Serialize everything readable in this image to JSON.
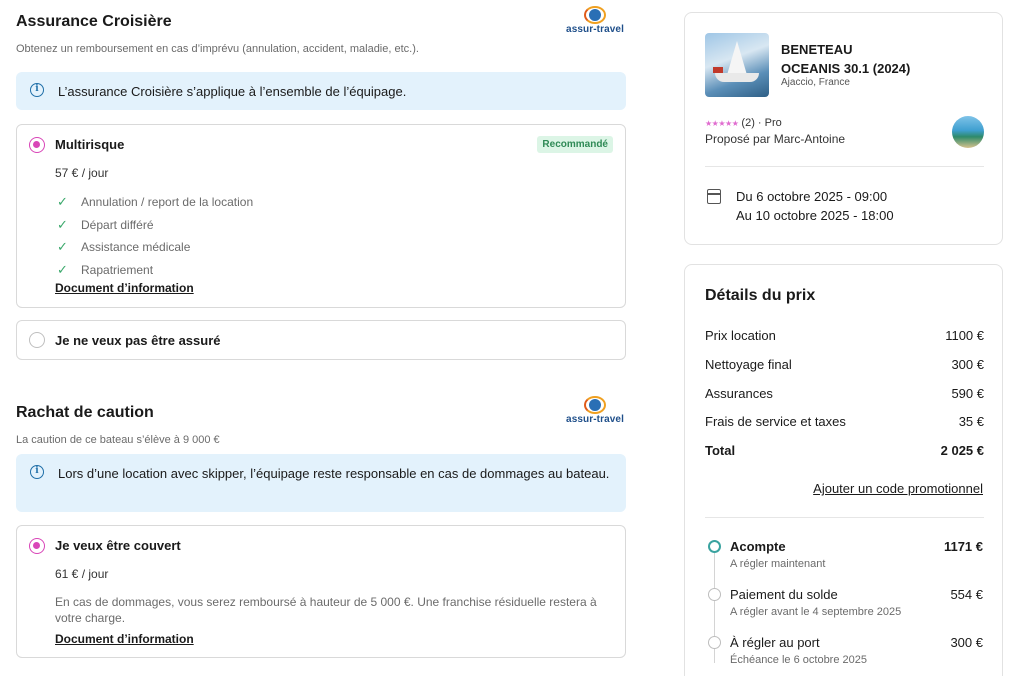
{
  "insurance": {
    "title": "Assurance Croisière",
    "subtitle": "Obtenez un remboursement en cas d’imprévu (annulation, accident, maladie, etc.).",
    "logo_text": "assur-travel",
    "info": "L’assurance Croisière s’applique à l’ensemble de l’équipage.",
    "options": [
      {
        "title": "Multirisque",
        "badge": "Recommandé",
        "price": "57 € / jour",
        "selected": true,
        "features": [
          "Annulation / report de la location",
          "Départ différé",
          "Assistance médicale",
          "Rapatriement"
        ],
        "doc_link": "Document d’information"
      },
      {
        "title": "Je ne veux pas être assuré",
        "selected": false
      }
    ]
  },
  "deposit": {
    "title": "Rachat de caution",
    "subtitle": "La caution de ce bateau s’élève à 9 000 €",
    "logo_text": "assur-travel",
    "info": "Lors d’une location avec skipper, l’équipage reste responsable en cas de dommages au bateau.",
    "option": {
      "title": "Je veux être couvert",
      "price": "61 € / jour",
      "selected": true,
      "description": "En cas de dommages, vous serez remboursé à hauteur de 5 000 €. Une franchise résiduelle restera à votre charge.",
      "doc_link": "Document d’information"
    }
  },
  "booking": {
    "boat_line1": "BENETEAU",
    "boat_line2": "OCEANIS 30.1 (2024)",
    "location": "Ajaccio, France",
    "rating_stars": "★★★★★",
    "rating_text": "(2) · Pro",
    "rating_value": 5,
    "owner": "Proposé par Marc-Antoine",
    "date_start": "Du 6 octobre 2025 - 09:00",
    "date_end": "Au 10 octobre 2025 - 18:00"
  },
  "price_details": {
    "title": "Détails du prix",
    "rows": [
      {
        "label": "Prix location",
        "value": "1100 €"
      },
      {
        "label": "Nettoyage final",
        "value": "300 €"
      },
      {
        "label": "Assurances",
        "value": "590 €"
      },
      {
        "label": "Frais de service et taxes",
        "value": "35 €"
      }
    ],
    "total_label": "Total",
    "total_value": "2 025 €",
    "promo_link": "Ajouter un code promotionnel",
    "schedule": [
      {
        "title": "Acompte",
        "sub": "A régler maintenant",
        "value": "1171 €",
        "active": true
      },
      {
        "title": "Paiement du solde",
        "sub": "A régler avant le 4 septembre 2025",
        "value": "554 €",
        "active": false
      },
      {
        "title": "À régler au port",
        "sub": "Échéance le 6 octobre 2025",
        "value": "300 €",
        "active": false
      }
    ]
  },
  "colors": {
    "accent": "#d946b8",
    "info_bg": "#e3f2fc",
    "badge_bg": "#dcf5e6",
    "badge_text": "#2f8a56",
    "check": "#3aa86b",
    "timeline_active": "#3aa3a0"
  }
}
